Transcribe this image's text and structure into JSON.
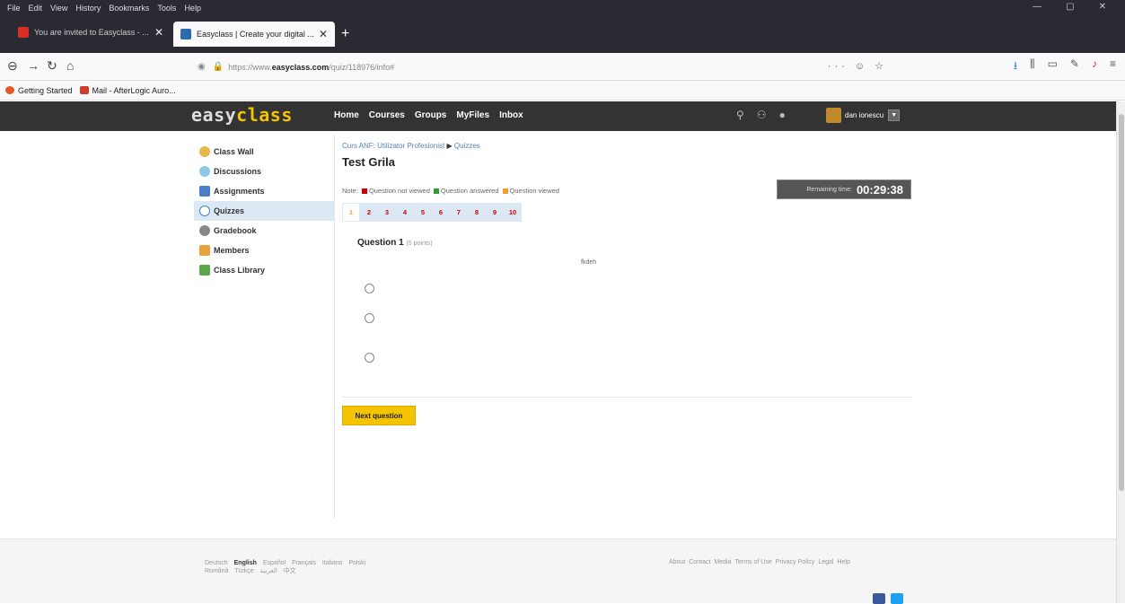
{
  "browser": {
    "menu": [
      "File",
      "Edit",
      "View",
      "History",
      "Bookmarks",
      "Tools",
      "Help"
    ],
    "window_controls": [
      "—",
      "▢",
      "✕"
    ],
    "tabs": [
      {
        "title": "You are invited to Easyclass - ..."
      },
      {
        "title": "Easyclass | Create your digital ..."
      }
    ],
    "new_tab": "+",
    "url_prefix": "https://www.",
    "url_host": "easyclass.com",
    "url_path": "/quiz/118976/info#",
    "url_actions": "··· ☺ ☆",
    "bookmarks": [
      {
        "label": "Getting Started",
        "color": "#e25920"
      },
      {
        "label": "Mail - AfterLogic Auro...",
        "color": "#d13b2a"
      }
    ]
  },
  "header": {
    "logo_a": "easy",
    "logo_b": "class",
    "nav": [
      "Home",
      "Courses",
      "Groups",
      "MyFiles",
      "Inbox"
    ],
    "user_name": "dan ionescu",
    "dropdown": "▼"
  },
  "sidebar": {
    "items": [
      {
        "label": "Class Wall",
        "color": "#e8b84a"
      },
      {
        "label": "Discussions",
        "color": "#8cc8e8"
      },
      {
        "label": "Assignments",
        "color": "#4a7fc8"
      },
      {
        "label": "Quizzes",
        "color": "#4a7fc8"
      },
      {
        "label": "Gradebook",
        "color": "#888888"
      },
      {
        "label": "Members",
        "color": "#e8a33d"
      },
      {
        "label": "Class Library",
        "color": "#5aa84a"
      }
    ]
  },
  "main": {
    "crumb_course": "Curs ANF: Utilizator Profesionist",
    "crumb_sep": "▶",
    "crumb_section": "Quizzes",
    "title": "Test Grila",
    "legend_note": "Note:",
    "legend": [
      {
        "label": "Question not viewed",
        "color": "#cc0000"
      },
      {
        "label": "Question answered",
        "color": "#339933"
      },
      {
        "label": "Question viewed",
        "color": "#f0a030"
      }
    ],
    "timer_label": "Remaining time:",
    "timer_value": "00:29:38",
    "question_numbers": [
      "1",
      "2",
      "3",
      "4",
      "5",
      "6",
      "7",
      "8",
      "9",
      "10"
    ],
    "question_label": "Question 1",
    "question_points": "(5 points)",
    "question_text": "fkdeh",
    "next_button": "Next question"
  },
  "footer": {
    "languages": [
      "Deutsch",
      "English",
      "Español",
      "Français",
      "Italiano",
      "Polski",
      "Română",
      "Türkçe",
      "العربية",
      "中文"
    ],
    "selected_language": "English",
    "links": [
      "About",
      "Contact",
      "Media",
      "Terms of Use",
      "Privacy Policy",
      "Legal",
      "Help"
    ],
    "social_colors": [
      "#3b5998",
      "#1da1f2"
    ]
  }
}
